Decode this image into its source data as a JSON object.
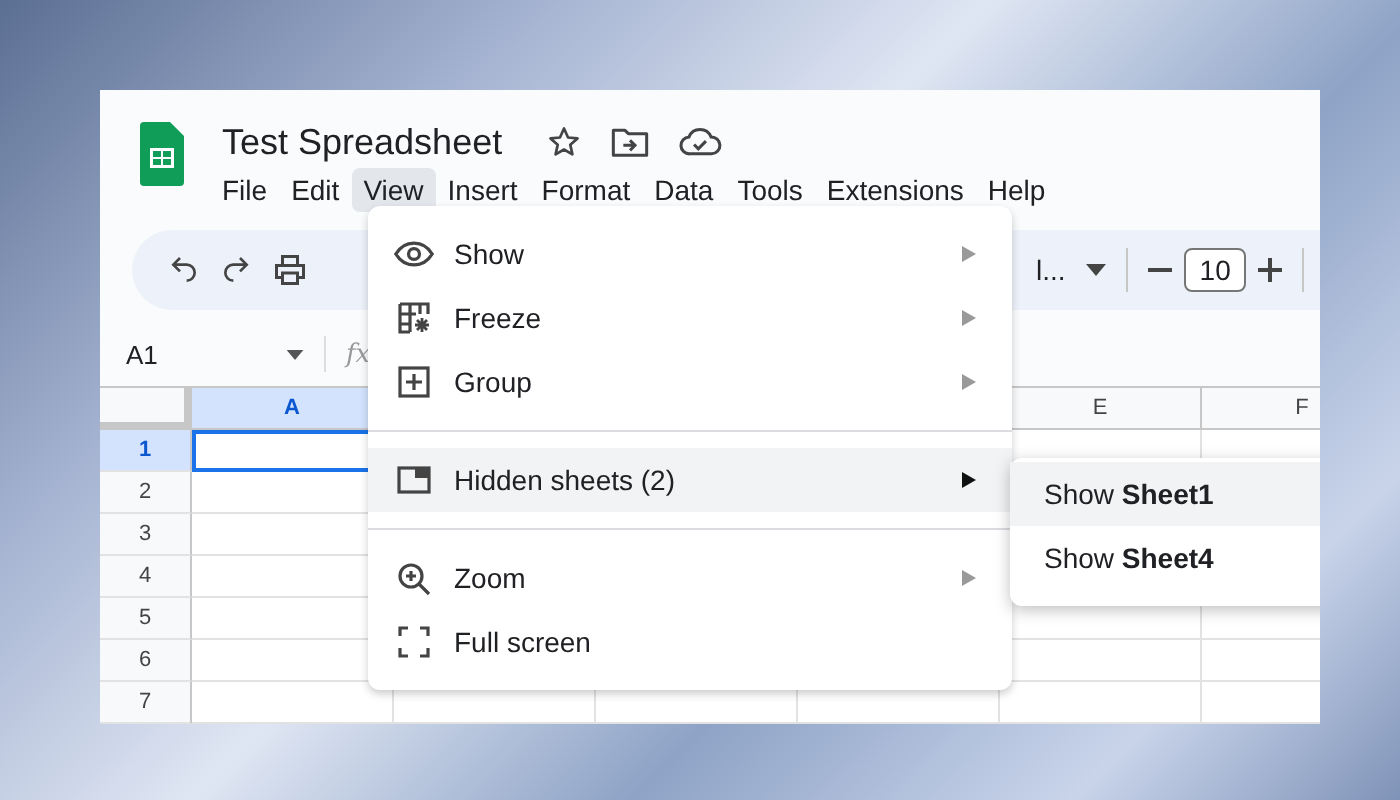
{
  "document": {
    "title": "Test Spreadsheet"
  },
  "menu_bar": [
    {
      "label": "File",
      "selected": false
    },
    {
      "label": "Edit",
      "selected": false
    },
    {
      "label": "View",
      "selected": true
    },
    {
      "label": "Insert",
      "selected": false
    },
    {
      "label": "Format",
      "selected": false
    },
    {
      "label": "Data",
      "selected": false
    },
    {
      "label": "Tools",
      "selected": false
    },
    {
      "label": "Extensions",
      "selected": false
    },
    {
      "label": "Help",
      "selected": false
    }
  ],
  "toolbar": {
    "font_name": "l...",
    "font_size": "10"
  },
  "formula_bar": {
    "name_box": "A1",
    "function_label": "fx"
  },
  "grid": {
    "columns": [
      {
        "label": "A",
        "selected": true
      },
      {
        "label": "E",
        "selected": false
      },
      {
        "label": "F",
        "selected": false
      }
    ],
    "rows": [
      {
        "label": "1",
        "selected": true
      },
      {
        "label": "2",
        "selected": false
      },
      {
        "label": "3",
        "selected": false
      },
      {
        "label": "4",
        "selected": false
      },
      {
        "label": "5",
        "selected": false
      },
      {
        "label": "6",
        "selected": false
      },
      {
        "label": "7",
        "selected": false
      }
    ]
  },
  "view_menu": [
    {
      "kind": "eye",
      "label": "Show",
      "submenu": true,
      "selected": false
    },
    {
      "kind": "freeze",
      "label": "Freeze",
      "submenu": true,
      "selected": false
    },
    {
      "kind": "group",
      "label": "Group",
      "submenu": true,
      "selected": false
    },
    {
      "kind": "divider"
    },
    {
      "kind": "sheet",
      "label": "Hidden sheets (2)",
      "submenu": true,
      "selected": true
    },
    {
      "kind": "divider"
    },
    {
      "kind": "zoom",
      "label": "Zoom",
      "submenu": true,
      "selected": false
    },
    {
      "kind": "fullscreen",
      "label": "Full screen",
      "submenu": false,
      "selected": false
    }
  ],
  "hidden_sheets_submenu": [
    {
      "label": "Show **Sheet1**",
      "selected": true
    },
    {
      "label": "Show **Sheet4**",
      "selected": false
    }
  ]
}
